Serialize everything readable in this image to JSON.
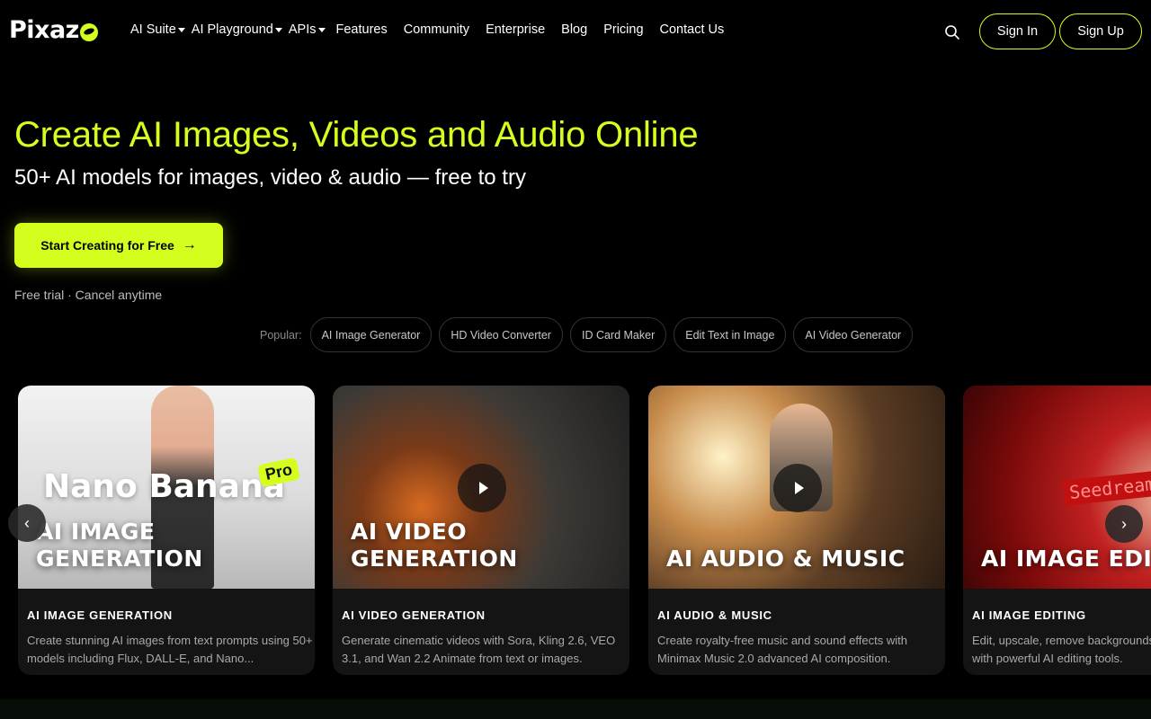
{
  "brand": {
    "name_prefix": "Pixaz",
    "accent": "#d4ff1e"
  },
  "nav": {
    "ai_suite": "AI Suite",
    "ai_playground": "AI Playground",
    "apis": "APIs",
    "features": "Features",
    "community": "Community",
    "enterprise": "Enterprise",
    "blog": "Blog",
    "pricing": "Pricing",
    "contact": "Contact Us"
  },
  "auth": {
    "sign_in": "Sign In",
    "sign_up": "Sign Up"
  },
  "hero": {
    "title": "Create AI Images, Videos and Audio Online",
    "subtitle": "50+ AI models for images, video & audio — free to try",
    "cta": "Start Creating for Free",
    "note": "Free trial · Cancel anytime"
  },
  "popular": {
    "label": "Popular:",
    "chips": [
      "AI Image Generator",
      "HD Video Converter",
      "ID Card Maker",
      "Edit Text in Image",
      "AI Video Generator"
    ]
  },
  "cards": [
    {
      "overlay_line1": "AI IMAGE",
      "overlay_line2": "GENERATION",
      "badge_text": "Nano Banana",
      "badge_pro": "Pro",
      "category": "AI IMAGE GENERATION",
      "description": "Create stunning AI images from text prompts using 50+ models including Flux, DALL-E, and Nano..."
    },
    {
      "overlay_line1": "AI VIDEO",
      "overlay_line2": "GENERATION",
      "category": "AI VIDEO GENERATION",
      "description": "Generate cinematic videos with Sora, Kling 2.6, VEO 3.1, and Wan 2.2 Animate from text or images."
    },
    {
      "overlay_line1": "AI AUDIO & MUSIC",
      "category": "AI AUDIO & MUSIC",
      "description": "Create royalty-free music and sound effects with Minimax Music 2.0 advanced AI composition."
    },
    {
      "overlay_line1": "AI IMAGE EDITING",
      "badge_text": "Seedream",
      "category": "AI IMAGE EDITING",
      "description": "Edit, upscale, remove backgrounds from your images with powerful AI editing tools."
    }
  ]
}
